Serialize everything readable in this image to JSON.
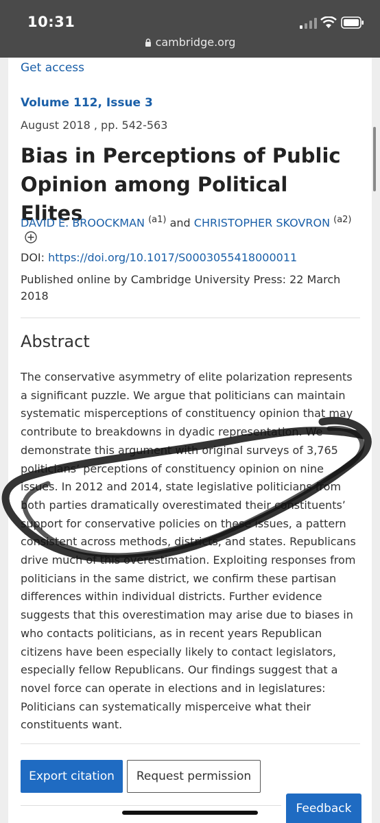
{
  "status_bar": {
    "time": "10:31",
    "url": "cambridge.org"
  },
  "article": {
    "get_access": "Get access",
    "volume": "Volume 112",
    "issue": "Issue 3",
    "date_pages": "August 2018 , pp. 542-563",
    "title": "Bias in Perceptions of Public Opinion among Political Elites",
    "author1": "DAVID E. BROOCKMAN",
    "author1_aff": "(a1)",
    "and": "and",
    "author2": "CHRISTOPHER SKOVRON",
    "author2_aff": "(a2)",
    "doi_label": "DOI:",
    "doi_link": "https://doi.org/10.1017/S0003055418000011",
    "published": "Published online by Cambridge University Press: 22 March 2018"
  },
  "abstract": {
    "heading": "Abstract",
    "text": "The conservative asymmetry of elite polarization represents a significant puzzle. We argue that politicians can maintain systematic misperceptions of constituency opinion that may contribute to breakdowns in dyadic representation. We demonstrate this argument with original surveys of 3,765 politicians’ perceptions of constituency opinion on nine issues. In 2012 and 2014, state legislative politicians from both parties dramatically overestimated their constituents’ support for conservative policies on these issues, a pattern consistent across methods, districts, and states. Republicans drive much of this overestimation. Exploiting responses from politicians in the same district, we confirm these partisan differences within individual districts. Further evidence suggests that this overestimation may arise due to biases in who contacts politicians, as in recent years Republican citizens have been especially likely to contact legislators, especially fellow Republicans. Our findings suggest that a novel force can operate in elections and in legislatures: Politicians can systematically misperceive what their constituents want."
  },
  "actions": {
    "export_citation": "Export citation",
    "request_permission": "Request permission",
    "feedback": "Feedback"
  },
  "colors": {
    "link": "#1a5fa8",
    "button": "#1f6bc2",
    "status_bar": "#4a4a4a"
  }
}
